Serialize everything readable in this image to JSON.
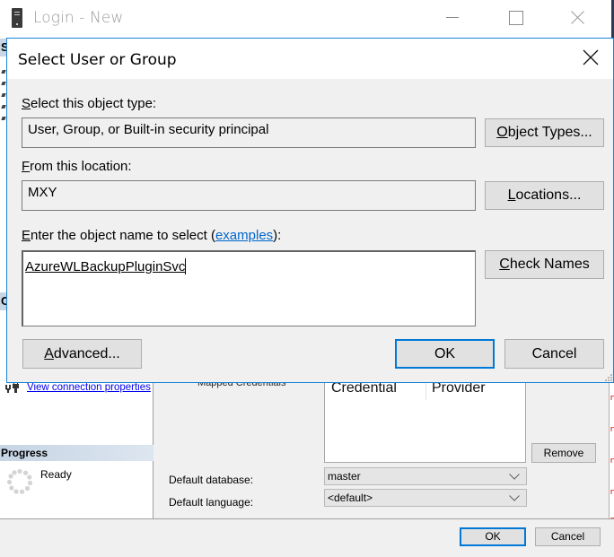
{
  "login_window": {
    "title": "Login - New",
    "left_panel": {
      "section_s_letter": "S",
      "section_c_letter": "C",
      "connection_link": "View connection properties",
      "progress_header": "Progress",
      "progress_status": "Ready"
    },
    "main": {
      "mapped_credentials_label": "Mapped Credentials",
      "credentials_table": {
        "columns": [
          "Credential",
          "Provider"
        ],
        "rows": []
      },
      "remove_button": "Remove",
      "default_database_label": "Default database:",
      "default_database_value": "master",
      "default_language_label": "Default language:",
      "default_language_value": "<default>"
    },
    "footer": {
      "ok_button": "OK",
      "cancel_button": "Cancel"
    }
  },
  "dialog": {
    "title": "Select User or Group",
    "object_type": {
      "label_accel": "S",
      "label_rest": "elect this object type:",
      "value": "User, Group, or Built-in security principal",
      "button_accel": "O",
      "button_rest": "bject Types..."
    },
    "location": {
      "label_accel": "F",
      "label_rest": "rom this location:",
      "value": "MXY",
      "button_accel": "L",
      "button_rest": "ocations..."
    },
    "object_name": {
      "label_accel": "E",
      "label_rest": "nter the object name to select (",
      "examples_link": "examples",
      "label_end": "):",
      "value": "AzureWLBackupPluginSvc",
      "button_accel": "C",
      "button_rest": "heck Names"
    },
    "advanced_button_accel": "A",
    "advanced_button_rest": "dvanced...",
    "ok_button": "OK",
    "cancel_button": "Cancel"
  },
  "colors": {
    "accent_blue": "#0078d7",
    "dialog_border": "#1883d7",
    "link_blue": "#0066cc",
    "background": "#f0f0f0",
    "button_face": "#e1e1e1"
  }
}
